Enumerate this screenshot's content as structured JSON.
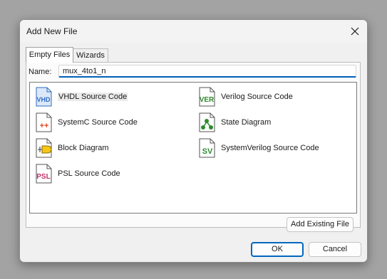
{
  "dialog": {
    "title": "Add New File",
    "tabs": [
      {
        "label": "Empty Files",
        "active": true
      },
      {
        "label": "Wizards",
        "active": false
      }
    ],
    "name_label": "Name:",
    "name_value": "mux_4to1_n",
    "file_types": [
      {
        "label": "VHDL Source Code",
        "icon": "vhdl-file-icon",
        "icon_text": "VHD",
        "selected": true
      },
      {
        "label": "Verilog Source Code",
        "icon": "verilog-file-icon",
        "icon_text": "VER"
      },
      {
        "label": "SystemC Source Code",
        "icon": "systemc-file-icon",
        "icon_text": "++"
      },
      {
        "label": "State Diagram",
        "icon": "state-diagram-icon"
      },
      {
        "label": "Block Diagram",
        "icon": "block-diagram-icon"
      },
      {
        "label": "SystemVerilog Source Code",
        "icon": "systemverilog-file-icon",
        "icon_text": "SV"
      },
      {
        "label": "PSL Source Code",
        "icon": "psl-file-icon",
        "icon_text": "PSL"
      }
    ],
    "buttons": {
      "add_existing": "Add Existing File",
      "ok": "OK",
      "cancel": "Cancel"
    },
    "colors": {
      "accent": "#005fb8",
      "vhdl": "#2d6cc0",
      "verilog": "#2e8b2e",
      "systemc": "#e0441c",
      "psl": "#c2336b"
    }
  }
}
